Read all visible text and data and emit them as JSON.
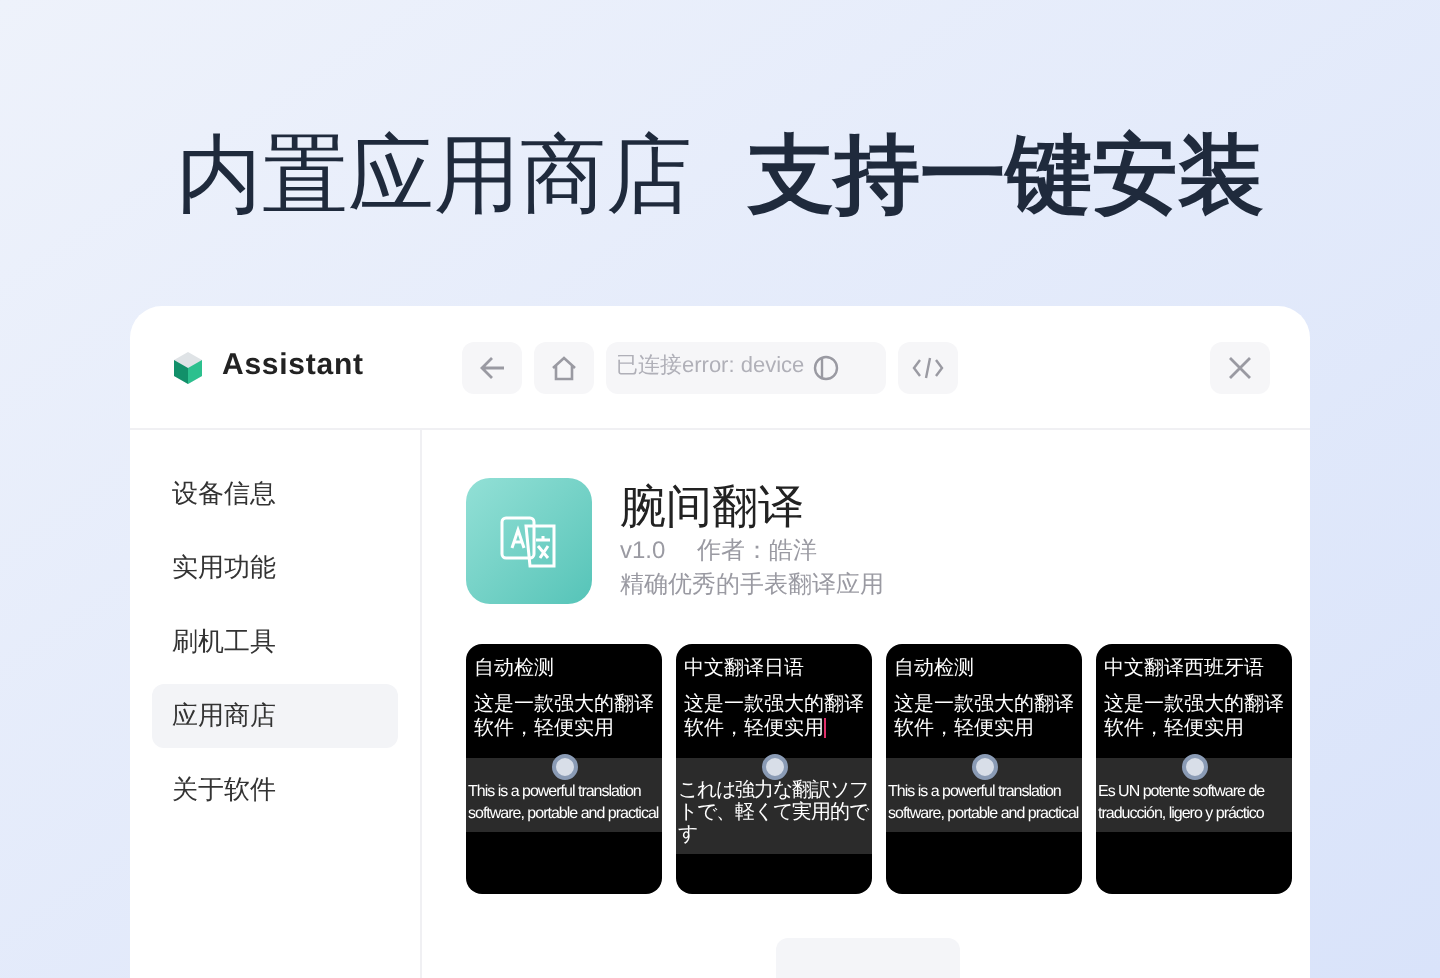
{
  "headline": [
    {
      "text": "内置应用商店",
      "bold": false
    },
    {
      "text": "支持一键安装",
      "bold": true
    }
  ],
  "window": {
    "title": "Assistant",
    "address": "已连接error: device"
  },
  "sidebar": {
    "items": [
      {
        "label": "设备信息",
        "selected": false
      },
      {
        "label": "实用功能",
        "selected": false
      },
      {
        "label": "刷机工具",
        "selected": false
      },
      {
        "label": "应用商店",
        "selected": true
      },
      {
        "label": "关于软件",
        "selected": false
      }
    ]
  },
  "app": {
    "name": "腕间翻译",
    "version": "v1.0",
    "author": "作者：皓洋",
    "description": "精确优秀的手表翻译应用"
  },
  "screenshots": [
    {
      "title": "自动检测",
      "source": "这是一款强大的翻译软件，轻便实用",
      "translation": "This is a powerful translation software, portable and practical",
      "cursor": false
    },
    {
      "title": "中文翻译日语",
      "source": "这是一款强大的翻译软件，轻便实用",
      "translation": "これは強力な翻訳ソフトで、軽くて実用的です",
      "cursor": true
    },
    {
      "title": "自动检测",
      "source": "这是一款强大的翻译软件，轻便实用",
      "translation": "This is a powerful translation software, portable and practical",
      "cursor": false
    },
    {
      "title": "中文翻译西班牙语",
      "source": "这是一款强大的翻译软件，轻便实用",
      "translation": "Es UN potente software de traducción, ligero y práctico",
      "cursor": false
    }
  ]
}
